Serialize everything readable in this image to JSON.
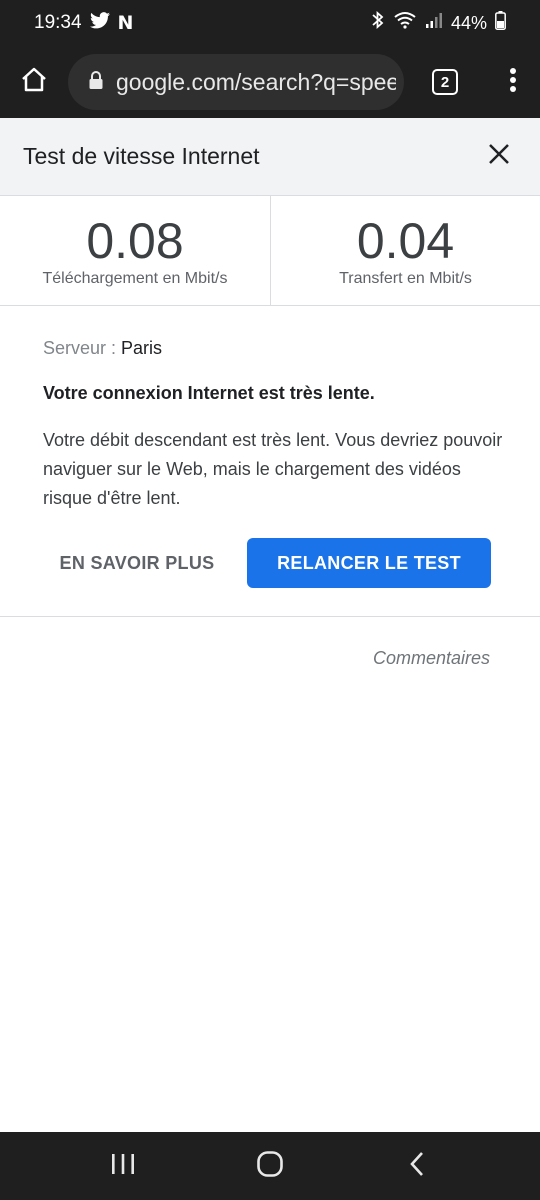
{
  "status_bar": {
    "time": "19:34",
    "battery": "44%",
    "icons": [
      "twitter-icon",
      "netflix-icon",
      "bluetooth-icon",
      "wifi-icon",
      "signal-icon",
      "battery-icon"
    ],
    "netflix_glyph": "N"
  },
  "toolbar": {
    "url": "google.com/search?q=speed+test",
    "tab_count": "2"
  },
  "card": {
    "title": "Test de vitesse Internet"
  },
  "results": {
    "download_value": "0.08",
    "download_label": "Téléchargement en Mbit/s",
    "upload_value": "0.04",
    "upload_label": "Transfert en Mbit/s"
  },
  "info": {
    "server_label": "Serveur : ",
    "server_name": "Paris",
    "headline": "Votre connexion Internet est très lente.",
    "description": "Votre débit descendant est très lent. Vous devriez pouvoir naviguer sur le Web, mais le chargement des vidéos risque d'être lent."
  },
  "actions": {
    "learn_more": "EN SAVOIR PLUS",
    "retest": "RELANCER LE TEST",
    "feedback": "Commentaires"
  },
  "colors": {
    "accent": "#1a73e8",
    "chrome_dark": "#1f1f1f"
  }
}
